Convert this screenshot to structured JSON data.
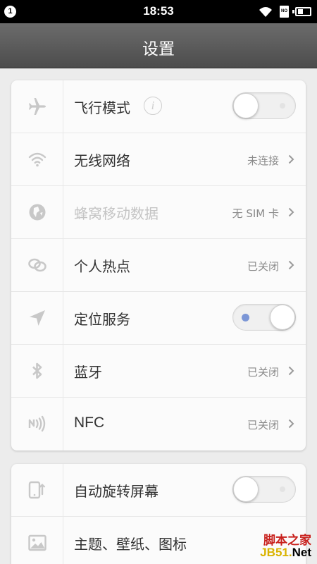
{
  "status_bar": {
    "notification_badge": "1",
    "time": "18:53",
    "sim_label": "NO",
    "icons": [
      "wifi-icon",
      "sim-icon",
      "battery-icon"
    ]
  },
  "header": {
    "title": "设置"
  },
  "sections": [
    {
      "rows": [
        {
          "icon": "airplane-icon",
          "label": "飞行模式",
          "info_icon": "i",
          "control": "toggle",
          "toggle_on": false
        },
        {
          "icon": "wifi-icon",
          "label": "无线网络",
          "value": "未连接",
          "control": "chevron"
        },
        {
          "icon": "cellular-data-icon",
          "label": "蜂窝移动数据",
          "value": "无 SIM 卡",
          "control": "chevron",
          "disabled": true
        },
        {
          "icon": "hotspot-icon",
          "label": "个人热点",
          "value": "已关闭",
          "control": "chevron"
        },
        {
          "icon": "location-icon",
          "label": "定位服务",
          "control": "toggle",
          "toggle_on": true
        },
        {
          "icon": "bluetooth-icon",
          "label": "蓝牙",
          "value": "已关闭",
          "control": "chevron"
        },
        {
          "icon": "nfc-icon",
          "label": "NFC",
          "value": "已关闭",
          "control": "chevron"
        }
      ]
    },
    {
      "rows": [
        {
          "icon": "auto-rotate-icon",
          "label": "自动旋转屏幕",
          "control": "toggle",
          "toggle_on": false
        },
        {
          "icon": "wallpaper-icon",
          "label": "主题、壁纸、图标",
          "control": "chevron"
        }
      ]
    }
  ],
  "watermark": {
    "line1": "脚本之家",
    "line2_prefix": "JB51.",
    "line2_suffix": "Net"
  },
  "colors": {
    "header": "#5a5a5a",
    "background": "#ececec",
    "card": "#fbfbfb",
    "toggle_dot": "#7b96d6",
    "watermark_red": "#c8201c",
    "watermark_yellow": "#d9b300"
  }
}
